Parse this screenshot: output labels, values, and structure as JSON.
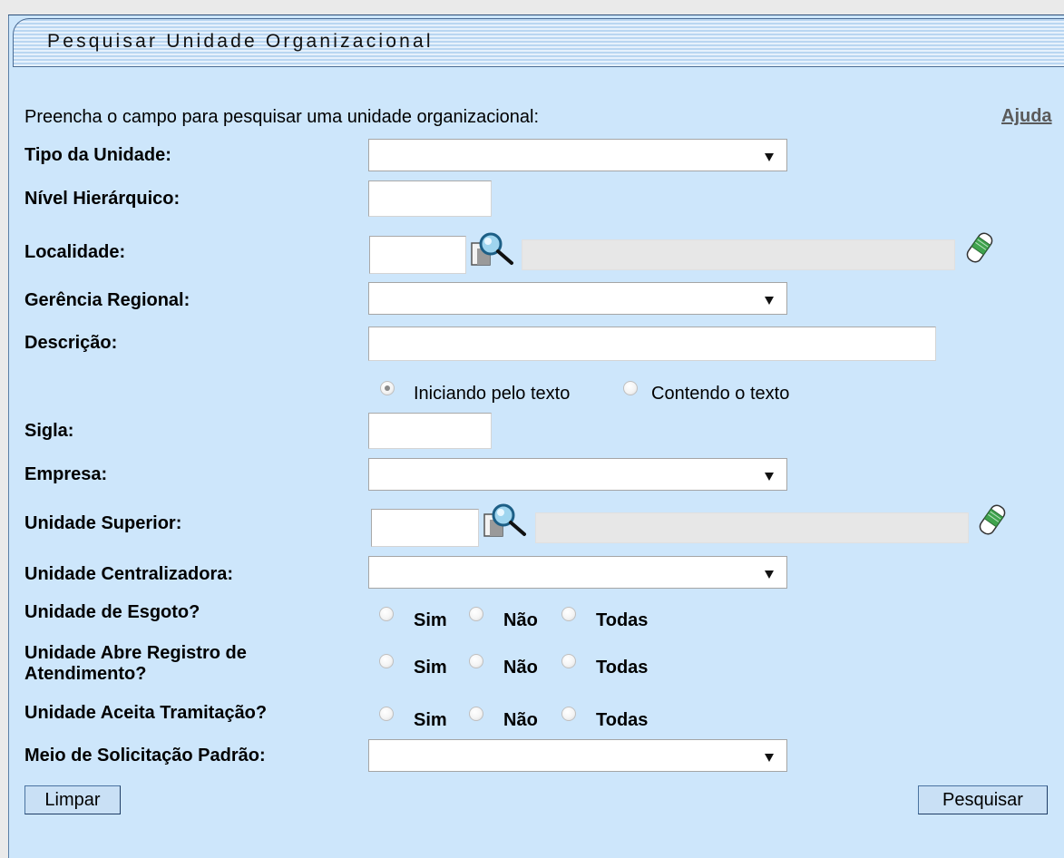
{
  "form": {
    "title": "Pesquisar Unidade Organizacional",
    "instruction": "Preencha o campo para pesquisar uma unidade organizacional:",
    "help_link": "Ajuda",
    "labels": {
      "tipo_unidade": "Tipo da Unidade:",
      "nivel_hierarquico": "Nível Hierárquico:",
      "localidade": "Localidade:",
      "gerencia_regional": "Gerência Regional:",
      "descricao": "Descrição:",
      "sigla": "Sigla:",
      "empresa": "Empresa:",
      "unidade_superior": "Unidade Superior:",
      "unidade_centralizadora": "Unidade Centralizadora:",
      "unidade_esgoto": "Unidade de Esgoto?",
      "unidade_abre_registro_1": "Unidade Abre Registro de",
      "unidade_abre_registro_2": "Atendimento?",
      "unidade_aceita_tramitacao": "Unidade Aceita Tramitação?",
      "meio_solicitacao": "Meio de Solicitação Padrão:"
    },
    "values": {
      "tipo_unidade": "",
      "nivel_hierarquico": "",
      "localidade_codigo": "",
      "localidade_nome": "",
      "gerencia_regional": "",
      "descricao": "",
      "sigla": "",
      "empresa": "",
      "unidade_superior_codigo": "",
      "unidade_superior_nome": "",
      "unidade_centralizadora": "",
      "meio_solicitacao": ""
    },
    "descricao_options": {
      "iniciando": "Iniciando pelo texto",
      "contendo": "Contendo o texto",
      "selected": "iniciando"
    },
    "yes_no_all": {
      "sim": "Sim",
      "nao": "Não",
      "todas": "Todas"
    },
    "buttons": {
      "limpar": "Limpar",
      "pesquisar": "Pesquisar"
    }
  },
  "icons": {
    "lookup": "magnifier-search-icon",
    "clear": "eraser-icon"
  }
}
